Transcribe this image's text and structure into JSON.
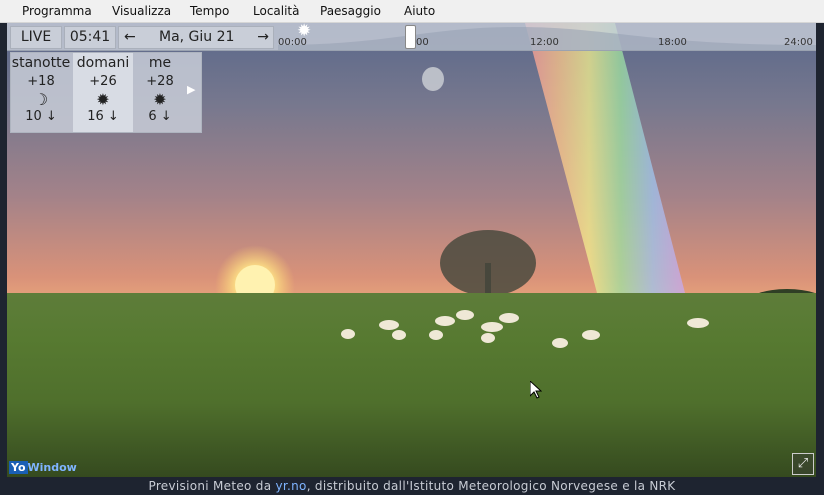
{
  "menu": [
    "Programma",
    "Visualizza",
    "Tempo",
    "Località",
    "Paesaggio",
    "Aiuto"
  ],
  "timebar": {
    "live": "LIVE",
    "time": "05:41",
    "date": "Ma, Giu 21",
    "ticks": [
      "00:00",
      "00",
      "12:00",
      "18:00",
      "24:00"
    ]
  },
  "forecast": [
    {
      "label": "stanotte",
      "temp": "+18",
      "icon": "moon",
      "wind": "10"
    },
    {
      "label": "domani",
      "temp": "+26",
      "icon": "sun",
      "wind": "16"
    },
    {
      "label": "me",
      "temp": "+28",
      "icon": "sun",
      "wind": "6"
    }
  ],
  "brand": {
    "yo": "Yo",
    "window": "Window"
  },
  "status": {
    "prefix": "Previsioni Meteo da",
    "link": "yr.no",
    "suffix": ", distribuito dall'Istituto Meteorologico Norvegese e la NRK"
  }
}
